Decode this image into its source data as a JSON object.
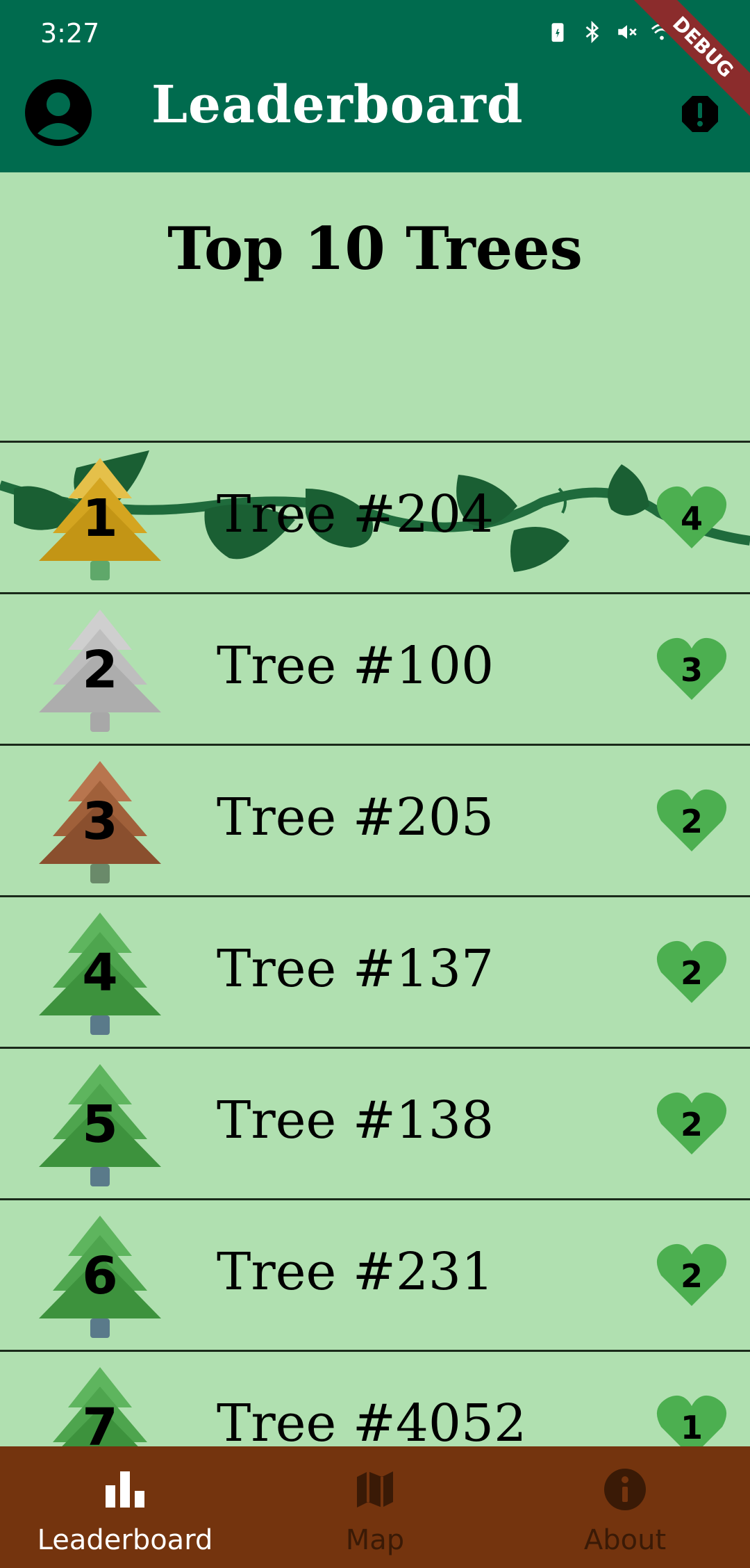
{
  "status_bar": {
    "time": "3:27"
  },
  "app_bar": {
    "title": "Leaderboard",
    "debug_label": "DEBUG"
  },
  "section": {
    "heading": "Top 10 Trees"
  },
  "leaderboard": [
    {
      "rank": "1",
      "name": "Tree #204",
      "votes": "4",
      "tier": "gold"
    },
    {
      "rank": "2",
      "name": "Tree #100",
      "votes": "3",
      "tier": "silver"
    },
    {
      "rank": "3",
      "name": "Tree #205",
      "votes": "2",
      "tier": "bronze"
    },
    {
      "rank": "4",
      "name": "Tree #137",
      "votes": "2",
      "tier": "green"
    },
    {
      "rank": "5",
      "name": "Tree #138",
      "votes": "2",
      "tier": "green"
    },
    {
      "rank": "6",
      "name": "Tree #231",
      "votes": "2",
      "tier": "green"
    },
    {
      "rank": "7",
      "name": "Tree #4052",
      "votes": "1",
      "tier": "green"
    }
  ],
  "bottom_nav": {
    "items": [
      {
        "label": "Leaderboard",
        "icon": "bar-chart-icon",
        "active": true
      },
      {
        "label": "Map",
        "icon": "map-icon",
        "active": false
      },
      {
        "label": "About",
        "icon": "info-icon",
        "active": false
      }
    ]
  },
  "colors": {
    "app_bar": "#006b4e",
    "background": "#b0e0b0",
    "bottom_nav": "#74340e",
    "heart": "#4caf50",
    "tier_gold": "#d4a520",
    "tier_silver": "#b8b8b8",
    "tier_bronze": "#a0603a",
    "tier_green": "#4ea54e"
  }
}
